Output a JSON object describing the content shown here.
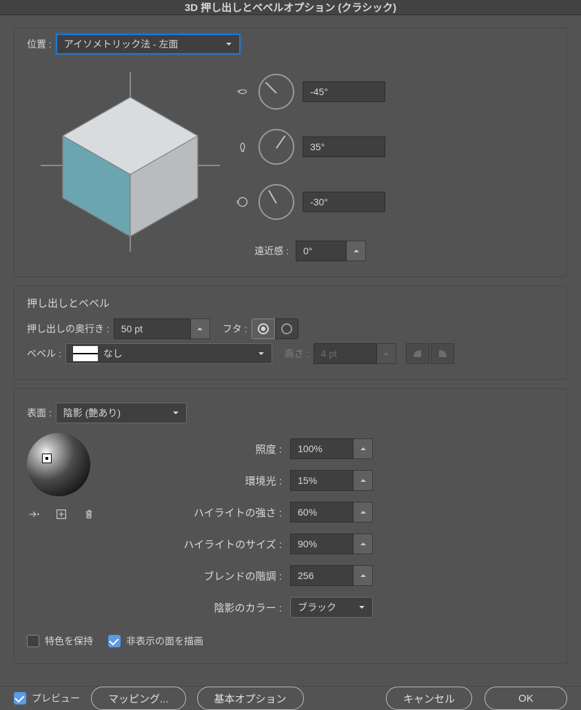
{
  "title": "3D 押し出しとベベルオプション (クラシック)",
  "position": {
    "label": "位置 :",
    "value": "アイソメトリック法 - 左面"
  },
  "rotation": {
    "x": "-45°",
    "y": "35°",
    "z": "-30°",
    "perspective_label": "遠近感 :",
    "perspective": "0°"
  },
  "extrude_section": {
    "title": "押し出しとベベル",
    "depth_label": "押し出しの奥行き :",
    "depth": "50 pt",
    "cap_label": "フタ :",
    "bevel_label": "ベベル :",
    "bevel_value": "なし",
    "height_label": "高さ :",
    "height": "4 pt"
  },
  "surface": {
    "label": "表面 :",
    "value": "陰影 (艶あり)",
    "intensity_label": "照度 :",
    "intensity": "100%",
    "ambient_label": "環境光 :",
    "ambient": "15%",
    "hi_intensity_label": "ハイライトの強さ :",
    "hi_intensity": "60%",
    "hi_size_label": "ハイライトのサイズ :",
    "hi_size": "90%",
    "blend_label": "ブレンドの階調 :",
    "blend": "256",
    "shade_color_label": "陰影のカラー :",
    "shade_color": "ブラック",
    "preserve_spot": "特色を保持",
    "draw_hidden": "非表示の面を描画"
  },
  "footer": {
    "preview": "プレビュー",
    "mapping": "マッピング...",
    "basic": "基本オプション",
    "cancel": "キャンセル",
    "ok": "OK"
  }
}
